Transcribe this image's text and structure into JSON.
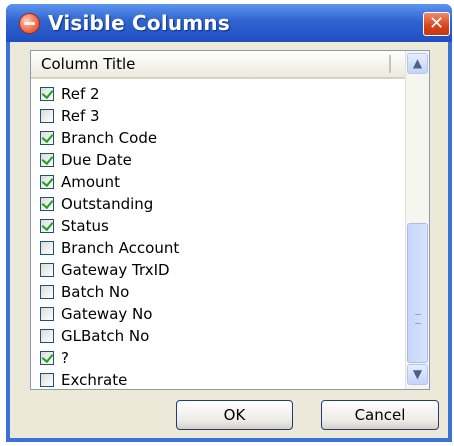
{
  "dialog": {
    "title": "Visible Columns",
    "app_icon": "app-icon",
    "close_glyph": "✕"
  },
  "list": {
    "header": "Column Title",
    "items": [
      {
        "label": "Ref 2",
        "checked": true
      },
      {
        "label": "Ref 3",
        "checked": false
      },
      {
        "label": "Branch Code",
        "checked": true
      },
      {
        "label": "Due Date",
        "checked": true
      },
      {
        "label": "Amount",
        "checked": true
      },
      {
        "label": "Outstanding",
        "checked": true
      },
      {
        "label": "Status",
        "checked": true
      },
      {
        "label": "Branch Account",
        "checked": false
      },
      {
        "label": "Gateway TrxID",
        "checked": false
      },
      {
        "label": "Batch No",
        "checked": false
      },
      {
        "label": "Gateway No",
        "checked": false
      },
      {
        "label": "GLBatch No",
        "checked": false
      },
      {
        "label": "?",
        "checked": true
      },
      {
        "label": "Exchrate",
        "checked": false
      }
    ]
  },
  "buttons": {
    "ok": "OK",
    "cancel": "Cancel"
  },
  "colors": {
    "title_bar": "#2f63d0",
    "close_button": "#d6431c",
    "check_mark": "#21a121"
  }
}
